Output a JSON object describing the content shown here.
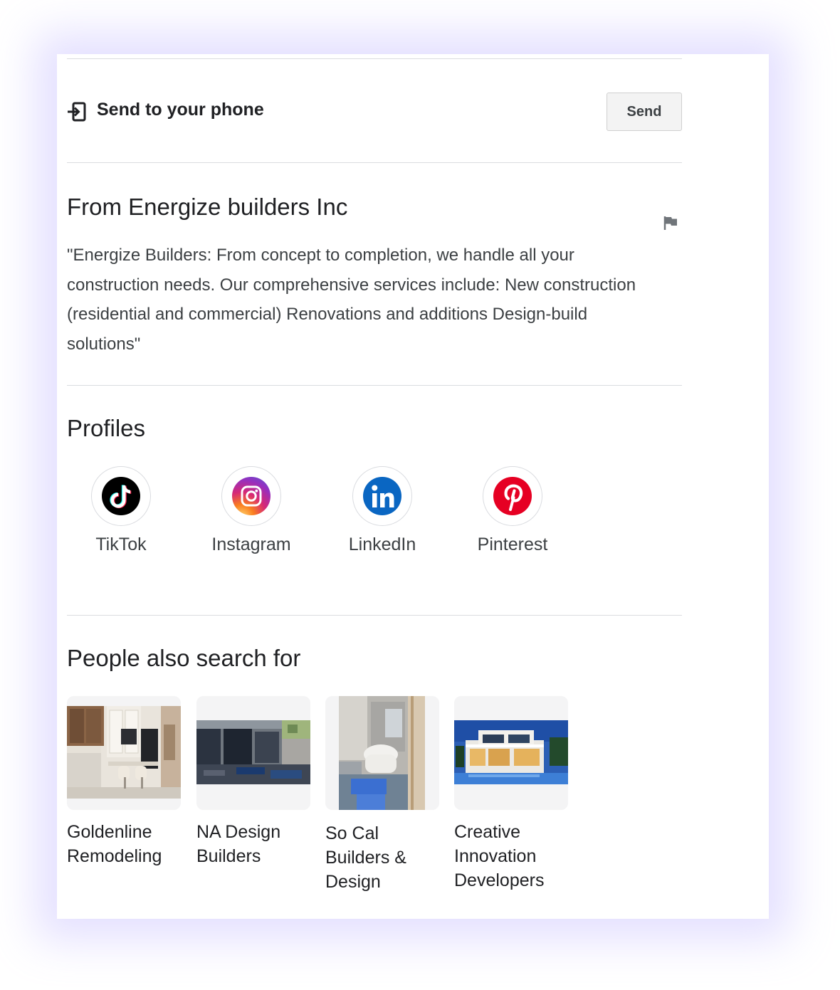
{
  "send_to_phone": {
    "label": "Send to your phone",
    "button_label": "Send"
  },
  "from_business": {
    "title": "From Energize builders Inc",
    "description": "\"Energize Builders: From concept to completion, we handle all your construction needs. Our comprehensive services include: New construction (residential and commercial) Renovations and additions Design-build solutions\""
  },
  "profiles": {
    "title": "Profiles",
    "items": [
      {
        "label": "TikTok",
        "icon": "tiktok-icon"
      },
      {
        "label": "Instagram",
        "icon": "instagram-icon"
      },
      {
        "label": "LinkedIn",
        "icon": "linkedin-icon"
      },
      {
        "label": "Pinterest",
        "icon": "pinterest-icon"
      }
    ]
  },
  "people_also_search": {
    "title": "People also search for",
    "items": [
      {
        "name": "Goldenline Remodeling",
        "thumbnail": "kitchen-interior-photo"
      },
      {
        "name": "NA Design Builders",
        "thumbnail": "modern-patio-photo"
      },
      {
        "name": "So Cal Builders & Design",
        "thumbnail": "bathroom-photo"
      },
      {
        "name": "Creative Innovation Developers",
        "thumbnail": "modern-house-night-photo"
      }
    ]
  },
  "colors": {
    "divider": "#dadce0",
    "text_primary": "#202124",
    "text_secondary": "#3c4043",
    "tiktok": "#000000",
    "instagram_gradient": [
      "#feda75",
      "#fa7e1e",
      "#d62976",
      "#962fbf",
      "#4f5bd5"
    ],
    "linkedin": "#0a66c2",
    "pinterest": "#e60023"
  }
}
